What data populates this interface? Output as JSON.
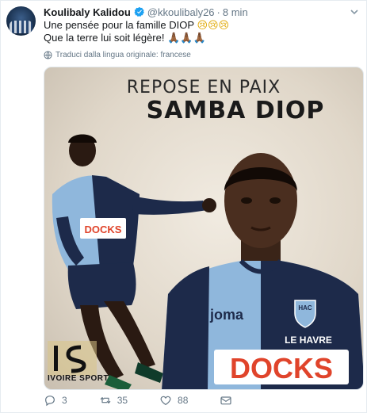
{
  "tweet": {
    "author_name": "Koulibaly Kalidou",
    "handle": "@kkoulibaly26",
    "separator": "·",
    "time": "8 min",
    "line1": "Une pensée pour la famille DIOP",
    "line1_emoji": "😢😢😢",
    "line2": "Que la terre lui soit légère!",
    "line2_emoji": "🙏🏾🙏🏾🙏🏾",
    "translate_label": "Traduci dalla lingua originale: francese"
  },
  "media": {
    "headline_top": "REPOSE EN PAIX",
    "headline_name": "SAMBA DIOP",
    "shirt_sponsor": "joma",
    "club_badge": "HAC",
    "sponsor_top": "LE HAVRE",
    "sponsor_main": "DOCKS",
    "watermark_brand": "IVOIRE SPORT"
  },
  "actions": {
    "replies": "3",
    "retweets": "35",
    "likes": "88"
  },
  "colors": {
    "text": "#14171a",
    "secondary": "#657786",
    "verified": "#1da1f2",
    "kit_navy": "#1d2a4a",
    "kit_sky": "#8fb7dc"
  },
  "icons": [
    "verified-badge-icon",
    "chevron-down-icon",
    "globe-icon",
    "reply-icon",
    "retweet-icon",
    "like-icon",
    "dm-icon"
  ]
}
